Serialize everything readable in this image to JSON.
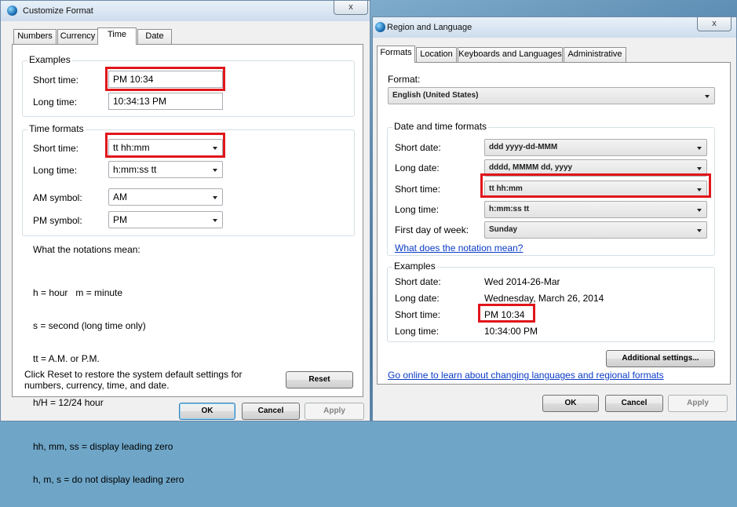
{
  "customize": {
    "title": "Customize Format",
    "close_label": "x",
    "tabs": [
      {
        "label": "Numbers"
      },
      {
        "label": "Currency"
      },
      {
        "label": "Time"
      },
      {
        "label": "Date"
      }
    ],
    "examples": {
      "group_title": "Examples",
      "short_label": "Short time:",
      "short_value": "PM 10:34",
      "long_label": "Long time:",
      "long_value": "10:34:13 PM"
    },
    "formats": {
      "group_title": "Time formats",
      "short_label": "Short time:",
      "short_value": "tt hh:mm",
      "long_label": "Long time:",
      "long_value": "h:mm:ss tt",
      "am_label": "AM symbol:",
      "am_value": "AM",
      "pm_label": "PM symbol:",
      "pm_value": "PM"
    },
    "notations": {
      "heading": "What the notations mean:",
      "lines": [
        "h = hour   m = minute",
        "s = second (long time only)",
        "tt = A.M. or P.M.",
        "h/H = 12/24 hour",
        "hh, mm, ss = display leading zero",
        "h, m, s = do not display leading zero"
      ]
    },
    "reset_text": "Click Reset to restore the system default settings for numbers, currency, time, and date.",
    "reset_label": "Reset",
    "ok_label": "OK",
    "cancel_label": "Cancel",
    "apply_label": "Apply"
  },
  "region": {
    "title": "Region and Language",
    "close_label": "x",
    "tabs": [
      {
        "label": "Formats"
      },
      {
        "label": "Location"
      },
      {
        "label": "Keyboards and Languages"
      },
      {
        "label": "Administrative"
      }
    ],
    "format_label": "Format:",
    "format_value": "English (United States)",
    "dt": {
      "group_title": "Date and time formats",
      "short_date_label": "Short date:",
      "short_date_value": "ddd yyyy-dd-MMM",
      "long_date_label": "Long date:",
      "long_date_value": "dddd, MMMM dd, yyyy",
      "short_time_label": "Short time:",
      "short_time_value": "tt hh:mm",
      "long_time_label": "Long time:",
      "long_time_value": "h:mm:ss tt",
      "first_day_label": "First day of week:",
      "first_day_value": "Sunday",
      "notation_link": "What does the notation mean?"
    },
    "examples": {
      "group_title": "Examples",
      "short_date_label": "Short date:",
      "short_date_value": "Wed 2014-26-Mar",
      "long_date_label": "Long date:",
      "long_date_value": "Wednesday, March 26, 2014",
      "short_time_label": "Short time:",
      "short_time_value": "PM 10:34",
      "long_time_label": "Long time:",
      "long_time_value": "10:34:00 PM"
    },
    "additional_label": "Additional settings...",
    "online_link": "Go online to learn about changing languages and regional formats",
    "ok_label": "OK",
    "cancel_label": "Cancel",
    "apply_label": "Apply"
  },
  "colors": {
    "highlight": "#e0161b",
    "link": "#0a3bc6"
  }
}
